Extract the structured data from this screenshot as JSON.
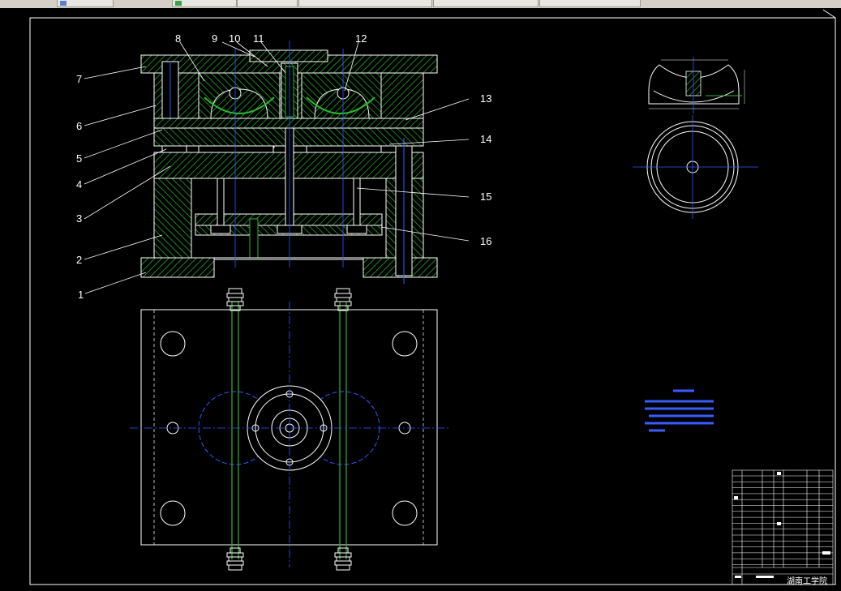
{
  "tabs": [
    {
      "label": "",
      "icon": "document-icon"
    },
    {
      "label": "",
      "icon": "document-icon"
    },
    {
      "label": "",
      "icon": "layout-icon"
    },
    {
      "label": "",
      "icon": "layout-icon"
    },
    {
      "label": "",
      "icon": "layout-icon"
    },
    {
      "label": "",
      "icon": "layout-icon"
    }
  ],
  "colors": {
    "background": "#000000",
    "outline": "#ffffff",
    "hatch": "#2db82d",
    "center_line": "#2f5bff",
    "leader": "#ffffff"
  },
  "part_numbers": [
    "1",
    "2",
    "3",
    "4",
    "5",
    "6",
    "7",
    "8",
    "9",
    "10",
    "11",
    "12",
    "13",
    "14",
    "15",
    "16"
  ],
  "title_block": {
    "school": "湖南工学院"
  }
}
